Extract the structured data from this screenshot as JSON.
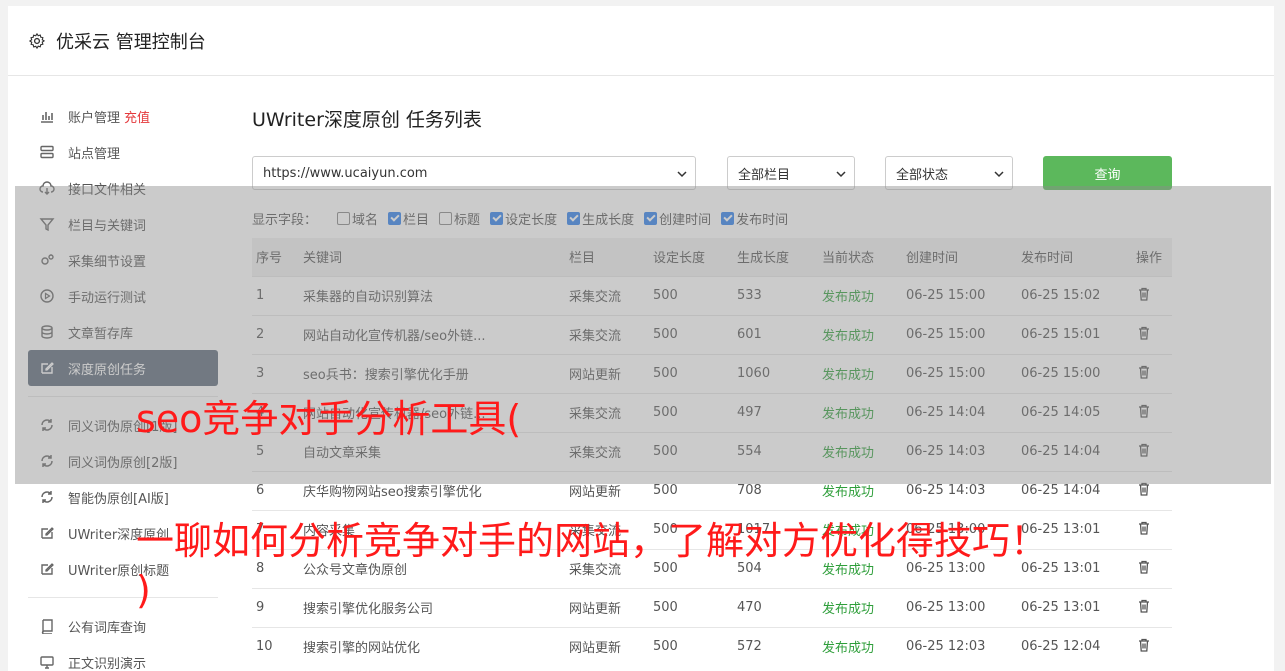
{
  "header": {
    "title": "优采云 管理控制台"
  },
  "sidebar": {
    "group1": [
      {
        "label": "账户管理",
        "tag": "充值",
        "icon": "bar-chart-icon"
      },
      {
        "label": "站点管理",
        "icon": "server-icon"
      },
      {
        "label": "接口文件相关",
        "icon": "cloud-download-icon"
      },
      {
        "label": "栏目与关键词",
        "icon": "filter-icon"
      },
      {
        "label": "采集细节设置",
        "icon": "gears-icon"
      },
      {
        "label": "手动运行测试",
        "icon": "play-circle-icon"
      },
      {
        "label": "文章暂存库",
        "icon": "database-icon"
      },
      {
        "label": "深度原创任务",
        "icon": "edit-icon",
        "active": true
      }
    ],
    "group2": [
      {
        "label": "同义词伪原创[1版]",
        "icon": "refresh-icon"
      },
      {
        "label": "同义词伪原创[2版]",
        "icon": "refresh-icon"
      },
      {
        "label": "智能伪原创[AI版]",
        "icon": "refresh-icon"
      },
      {
        "label": "UWriter深度原创",
        "icon": "edit-icon"
      },
      {
        "label": "UWriter原创标题",
        "icon": "edit-icon"
      }
    ],
    "group3": [
      {
        "label": "公有词库查询",
        "icon": "book-icon"
      },
      {
        "label": "正文识别演示",
        "icon": "monitor-icon"
      }
    ]
  },
  "main": {
    "title": "UWriter深度原创 任务列表",
    "site_select": "https://www.ucaiyun.com",
    "column_select": "全部栏目",
    "status_select": "全部状态",
    "query_label": "查询",
    "fields_label": "显示字段：",
    "fields": [
      {
        "label": "域名",
        "checked": false
      },
      {
        "label": "栏目",
        "checked": true
      },
      {
        "label": "标题",
        "checked": false
      },
      {
        "label": "设定长度",
        "checked": true
      },
      {
        "label": "生成长度",
        "checked": true
      },
      {
        "label": "创建时间",
        "checked": true
      },
      {
        "label": "发布时间",
        "checked": true
      }
    ],
    "columns": [
      "序号",
      "关键词",
      "栏目",
      "设定长度",
      "生成长度",
      "当前状态",
      "创建时间",
      "发布时间",
      "操作"
    ],
    "rows": [
      [
        "1",
        "采集器的自动识别算法",
        "采集交流",
        "500",
        "533",
        "发布成功",
        "06-25 15:00",
        "06-25 15:02"
      ],
      [
        "2",
        "网站自动化宣传机器/seo外链...",
        "采集交流",
        "500",
        "601",
        "发布成功",
        "06-25 15:00",
        "06-25 15:01"
      ],
      [
        "3",
        "seo兵书：搜索引擎优化手册",
        "网站更新",
        "500",
        "1060",
        "发布成功",
        "06-25 15:00",
        "06-25 15:00"
      ],
      [
        "4",
        "网站自动化宣传机器/seo外链...",
        "采集交流",
        "500",
        "497",
        "发布成功",
        "06-25 14:04",
        "06-25 14:05"
      ],
      [
        "5",
        "自动文章采集",
        "采集交流",
        "500",
        "554",
        "发布成功",
        "06-25 14:03",
        "06-25 14:04"
      ],
      [
        "6",
        "庆华购物网站seo搜索引擎优化",
        "网站更新",
        "500",
        "708",
        "发布成功",
        "06-25 14:03",
        "06-25 14:04"
      ],
      [
        "7",
        "内容采集",
        "采集交流",
        "500",
        "1017",
        "发布成功",
        "06-25 13:00",
        "06-25 13:01"
      ],
      [
        "8",
        "公众号文章伪原创",
        "采集交流",
        "500",
        "504",
        "发布成功",
        "06-25 13:00",
        "06-25 13:01"
      ],
      [
        "9",
        "搜索引擎优化服务公司",
        "网站更新",
        "500",
        "470",
        "发布成功",
        "06-25 13:00",
        "06-25 13:01"
      ],
      [
        "10",
        "搜索引擎的网站优化",
        "网站更新",
        "500",
        "572",
        "发布成功",
        "06-25 12:03",
        "06-25 12:04"
      ]
    ]
  },
  "overlay": {
    "line1": "seo竞争对手分析工具(",
    "line2": "一聊如何分析竞争对手的网站，了解对方优化得技巧！",
    "line3": ")"
  }
}
